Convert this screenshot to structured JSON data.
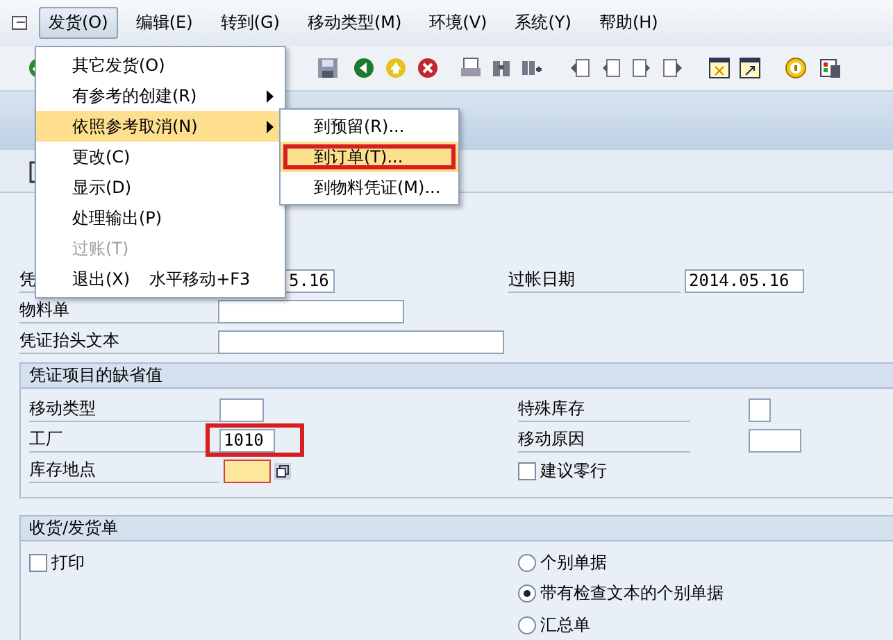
{
  "menubar": {
    "items": [
      {
        "label": "发货(O)",
        "selected": true
      },
      {
        "label": "编辑(E)",
        "selected": false
      },
      {
        "label": "转到(G)",
        "selected": false
      },
      {
        "label": "移动类型(M)",
        "selected": false
      },
      {
        "label": "环境(V)",
        "selected": false
      },
      {
        "label": "系统(Y)",
        "selected": false
      },
      {
        "label": "帮助(H)",
        "selected": false
      }
    ]
  },
  "menu": {
    "items": [
      {
        "label": "其它发货(O)",
        "submenu": false,
        "highlighted": false,
        "disabled": false
      },
      {
        "label": "有参考的创建(R)",
        "submenu": true,
        "highlighted": false,
        "disabled": false
      },
      {
        "label": "依照参考取消(N)",
        "submenu": true,
        "highlighted": true,
        "disabled": false
      },
      {
        "label": "更改(C)",
        "submenu": false,
        "highlighted": false,
        "disabled": false
      },
      {
        "label": "显示(D)",
        "submenu": false,
        "highlighted": false,
        "disabled": false
      },
      {
        "label": "处理输出(P)",
        "submenu": false,
        "highlighted": false,
        "disabled": false
      },
      {
        "label": "过账(T)",
        "submenu": false,
        "highlighted": false,
        "disabled": true
      },
      {
        "label": "退出(X)",
        "shortcut": "水平移动+F3",
        "submenu": false,
        "highlighted": false,
        "disabled": false
      }
    ]
  },
  "submenu": {
    "items": [
      {
        "label": "到预留(R)...",
        "highlighted": false,
        "marked": false
      },
      {
        "label": "到订单(T)...",
        "highlighted": true,
        "marked": true
      },
      {
        "label": "到物料凭证(M)...",
        "highlighted": false,
        "marked": false
      }
    ]
  },
  "header": {
    "doc_date_label": "凭",
    "doc_date_value": "5.16",
    "posting_date_label": "过帐日期",
    "posting_date_value": "2014.05.16",
    "material_slip_label": "物料单",
    "header_text_label": "凭证抬头文本"
  },
  "defaults": {
    "title": "凭证项目的缺省值",
    "movement_type_label": "移动类型",
    "special_stock_label": "特殊库存",
    "plant_label": "工厂",
    "plant_value": "1010",
    "plant_marked": true,
    "reason_label": "移动原因",
    "storage_location_label": "库存地点",
    "suggest_zero_label": "建议零行",
    "suggest_zero_checked": false
  },
  "slip": {
    "title": "收货/发货单",
    "print_label": "打印",
    "print_checked": false,
    "options": [
      {
        "label": "个别单据",
        "selected": false
      },
      {
        "label": "带有检查文本的个别单据",
        "selected": true
      },
      {
        "label": "汇总单",
        "selected": false
      }
    ]
  }
}
